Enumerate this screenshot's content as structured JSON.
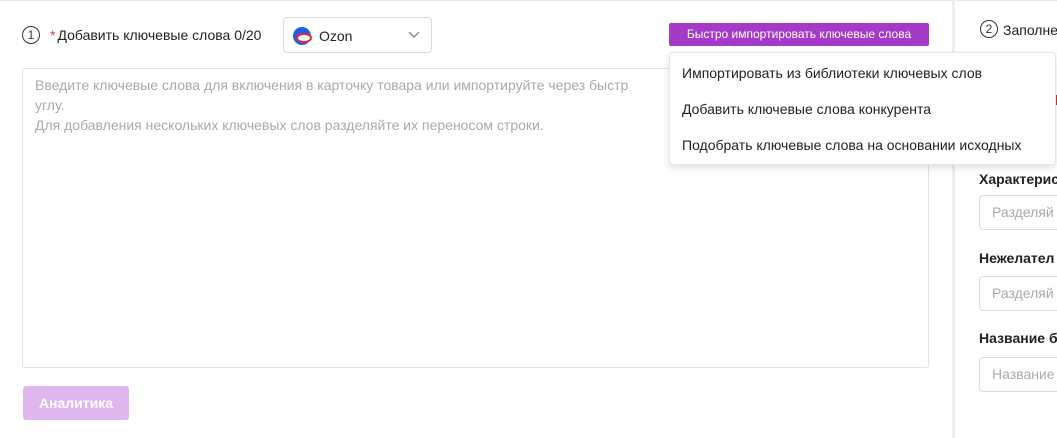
{
  "keywords_section": {
    "step_number": "1",
    "required_mark": "*",
    "title": "Добавить ключевые слова",
    "counter": "0/20",
    "platform": {
      "selected": "Ozon",
      "icon": "ozon-logo-icon"
    },
    "import_button_label": "Быстро импортировать ключевые слова",
    "textarea_placeholder_lines": [
      "Введите ключевые слова для включения в карточку товара или импортируйте через быстр",
      "углу.",
      "Для добавления нескольких ключевых слов разделяйте их переносом строки."
    ],
    "analytics_button_label": "Аналитика"
  },
  "import_menu": {
    "items": [
      "Импортировать из библиотеки ключевых слов",
      "Добавить ключевые слова конкурента",
      "Подобрать ключевые слова на основании исходных"
    ]
  },
  "right_panel": {
    "step_number": "2",
    "title": "Заполне",
    "fields": [
      {
        "label": "Характерис",
        "placeholder": "Разделяй"
      },
      {
        "label": "Нежелател",
        "placeholder": "Разделяй"
      },
      {
        "label": "Название б",
        "placeholder": "Название"
      }
    ]
  },
  "colors": {
    "accent": "#a53ac8",
    "accent_disabled": "#dfb6ee",
    "required": "#e53935"
  }
}
